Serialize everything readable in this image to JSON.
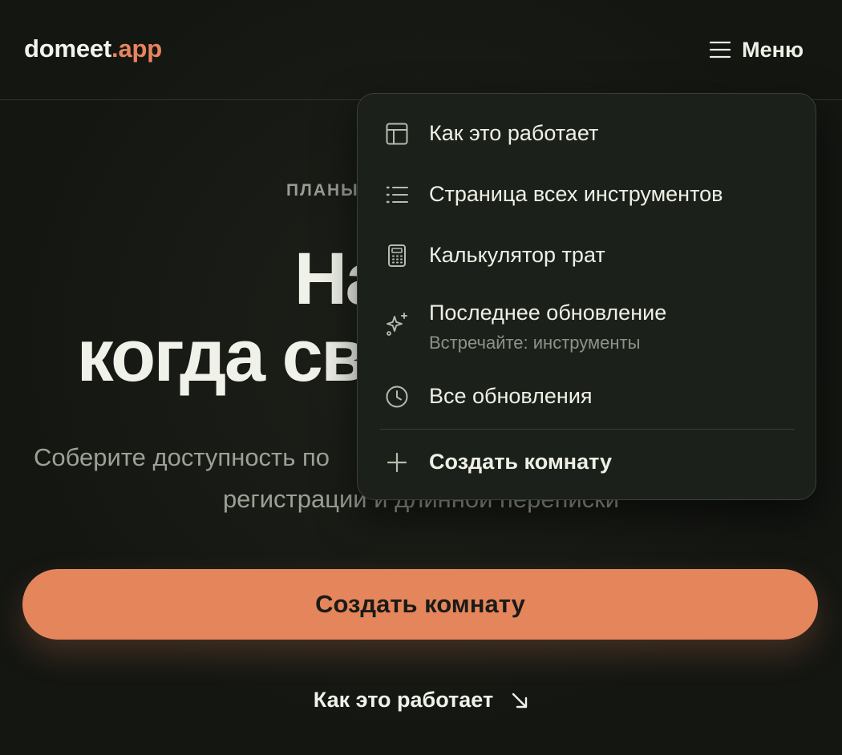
{
  "header": {
    "logo_main": "domeet",
    "logo_accent": ".app",
    "menu_label": "Меню"
  },
  "hero": {
    "eyebrow": "ПЛАНЫ",
    "headline_line1": "Найди",
    "headline_line2": "когда св",
    "subtitle_line1": "Соберите доступность по",
    "subtitle_line2": "регистрации и длинной переписки",
    "cta_label": "Создать комнату",
    "how_link_label": "Как это работает"
  },
  "menu": {
    "items": [
      {
        "label": "Как это работает",
        "icon": "layout-icon"
      },
      {
        "label": "Страница всех инструментов",
        "icon": "list-icon"
      },
      {
        "label": "Калькулятор трат",
        "icon": "calculator-icon"
      },
      {
        "label": "Последнее обновление",
        "sublabel": "Встречайте: инструменты",
        "icon": "sparkles-icon"
      },
      {
        "label": "Все обновления",
        "icon": "clock-icon"
      }
    ],
    "create_label": "Создать комнату"
  },
  "colors": {
    "accent": "#e5855c",
    "background": "#161814",
    "menu_background": "#1c201a"
  }
}
